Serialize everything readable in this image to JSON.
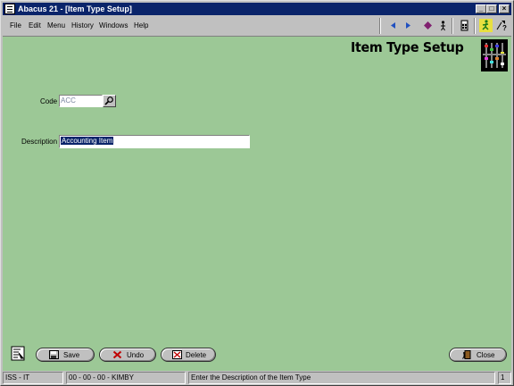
{
  "window": {
    "title": "Abacus 21 - [Item Type Setup]",
    "minimize_glyph": "_",
    "restore_glyph": "□",
    "close_glyph": "×"
  },
  "menu": {
    "file": "File",
    "edit": "Edit",
    "menu": "Menu",
    "history": "History",
    "windows": "Windows",
    "help": "Help"
  },
  "toolbar": {
    "icons": [
      "arrow-left-icon",
      "arrow-right-icon",
      "diamond-icon",
      "person-icon",
      "calculator-icon",
      "running-man-icon",
      "help-icon"
    ]
  },
  "form": {
    "heading": "Item Type Setup",
    "code_label": "Code",
    "code_value": "ACC",
    "description_label": "Description",
    "description_value": "Accounting Item"
  },
  "buttons": {
    "save": "Save",
    "undo": "Undo",
    "delete": "Delete",
    "close": "Close"
  },
  "status": {
    "mode": "ISS - IT",
    "user": "00 - 00 - 00 - KIMBY",
    "message": "Enter the Description of the Item Type",
    "page": "1"
  },
  "colors": {
    "content_bg": "#9cc896",
    "titlebar_bg": "#0a246a",
    "selection_bg": "#0a246a"
  }
}
